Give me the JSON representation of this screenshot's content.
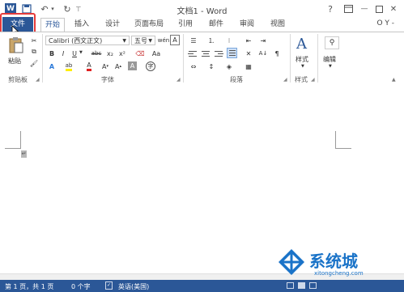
{
  "window": {
    "title": "文档1 - Word",
    "help_icon": "?",
    "minimize_icon": "—",
    "close_icon": "✕"
  },
  "tabs": {
    "file": "文件",
    "home": "开始",
    "insert": "插入",
    "design": "设计",
    "layout": "页面布局",
    "references": "引用",
    "mailings": "邮件",
    "review": "审阅",
    "view": "视图"
  },
  "account": "O Y -",
  "ribbon": {
    "clipboard": {
      "paste_label": "粘贴",
      "group_label": "剪贴板"
    },
    "font": {
      "font_name": "Calibri (西文正文)",
      "font_size": "五号",
      "group_label": "字体",
      "bold": "B",
      "italic": "I",
      "underline": "U",
      "strike": "abc",
      "subscript": "x₂",
      "superscript": "x²",
      "color_a": "A",
      "char_border": "A"
    },
    "paragraph": {
      "group_label": "段落"
    },
    "styles": {
      "label": "样式",
      "group_label": "样式"
    },
    "editing": {
      "label": "编辑"
    }
  },
  "statusbar": {
    "page": "第 1 页，共 1 页",
    "words": "0 个字",
    "language": "英语(美国)"
  },
  "watermark": {
    "brand": "系统城",
    "url": "xitongcheng.com"
  }
}
